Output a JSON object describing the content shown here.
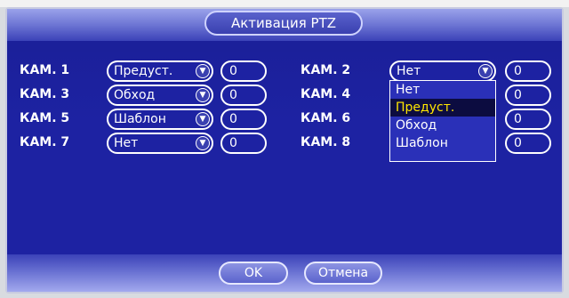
{
  "dialog": {
    "title": "Активация PTZ"
  },
  "rows": [
    {
      "label": "КАМ. 1",
      "value": "Предуст.",
      "num": "0"
    },
    {
      "label": "КАМ. 2",
      "value": "Нет",
      "num": "0"
    },
    {
      "label": "КАМ. 3",
      "value": "Обход",
      "num": "0"
    },
    {
      "label": "КАМ. 4",
      "value": "",
      "num": "0"
    },
    {
      "label": "КАМ. 5",
      "value": "Шаблон",
      "num": "0"
    },
    {
      "label": "КАМ. 6",
      "value": "",
      "num": "0"
    },
    {
      "label": "КАМ. 7",
      "value": "Нет",
      "num": "0"
    },
    {
      "label": "КАМ. 8",
      "value": "",
      "num": "0"
    }
  ],
  "dropdown": {
    "options": [
      "Нет",
      "Предуст.",
      "Обход",
      "Шаблон"
    ],
    "highlighted": "Предуст."
  },
  "footer": {
    "ok": "OK",
    "cancel": "Отмена"
  },
  "icons": {
    "select_arrow": "chevron-down-icon"
  },
  "colors": {
    "background": "#1d22a2",
    "highlight_bg": "#0c0c40",
    "highlight_text": "#ffe600"
  }
}
